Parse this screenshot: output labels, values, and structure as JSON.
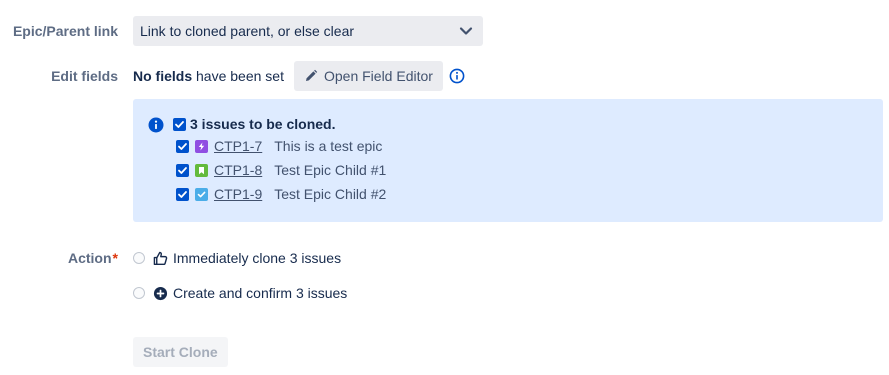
{
  "epic_parent": {
    "label": "Epic/Parent link",
    "value": "Link to cloned parent, or else clear"
  },
  "edit_fields": {
    "label": "Edit fields",
    "no_fields_bold": "No fields",
    "no_fields_rest": " have been set",
    "button_label": "Open Field Editor"
  },
  "clone_panel": {
    "header": "3 issues to be cloned.",
    "issues": [
      {
        "key": "CTP1-7",
        "summary": "This is a test epic",
        "type_icon": "epic-icon",
        "type_color": "#904ee2"
      },
      {
        "key": "CTP1-8",
        "summary": "Test Epic Child #1",
        "type_icon": "story-icon",
        "type_color": "#63ba3c"
      },
      {
        "key": "CTP1-9",
        "summary": "Test Epic Child #2",
        "type_icon": "task-icon",
        "type_color": "#4bade8"
      }
    ]
  },
  "action": {
    "label": "Action",
    "required_mark": "*",
    "options": [
      {
        "label": "Immediately clone 3 issues",
        "icon": "thumbs-up-icon"
      },
      {
        "label": "Create and confirm 3 issues",
        "icon": "plus-circle-icon"
      }
    ]
  },
  "start_button": {
    "label": "Start Clone"
  },
  "colors": {
    "accent": "#0052cc",
    "panel_bg": "#deebff",
    "label_gray": "#5e6c84",
    "required": "#de350b"
  }
}
